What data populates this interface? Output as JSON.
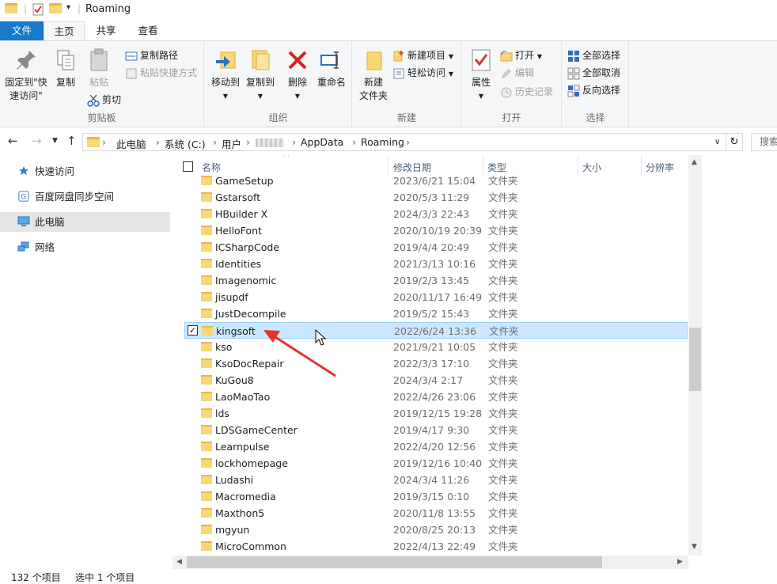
{
  "window": {
    "title": "Roaming"
  },
  "menu": {
    "file": "文件",
    "home": "主页",
    "share": "共享",
    "view": "查看"
  },
  "ribbon": {
    "clipboard": {
      "label": "剪贴板",
      "pin_line1": "固定到\"快",
      "pin_line2": "速访问\"",
      "copy": "复制",
      "paste": "粘贴",
      "copy_path": "复制路径",
      "paste_shortcut": "粘贴快捷方式",
      "cut": "剪切"
    },
    "organize": {
      "label": "组织",
      "move_to": "移动到",
      "copy_to": "复制到",
      "delete": "删除",
      "rename": "重命名"
    },
    "new": {
      "label": "新建",
      "new_item": "新建项目",
      "easy_access": "轻松访问",
      "new_folder_line1": "新建",
      "new_folder_line2": "文件夹"
    },
    "open": {
      "label": "打开",
      "properties": "属性",
      "open": "打开",
      "edit": "编辑",
      "history": "历史记录"
    },
    "select": {
      "label": "选择",
      "select_all": "全部选择",
      "select_none": "全部取消",
      "invert": "反向选择"
    }
  },
  "address": {
    "crumbs": [
      "此电脑",
      "系统 (C:)",
      "用户",
      "AppData",
      "Roaming"
    ],
    "search_placeholder": "搜索"
  },
  "nav": {
    "items": [
      "快速访问",
      "百度网盘同步空间",
      "此电脑",
      "网络"
    ]
  },
  "columns": {
    "name": "名称",
    "date": "修改日期",
    "type": "类型",
    "size": "大小",
    "resolution": "分辨率"
  },
  "files": [
    {
      "name": "GameSetup",
      "date": "2023/6/21 15:04",
      "type": "文件夹"
    },
    {
      "name": "Gstarsoft",
      "date": "2020/5/3 11:29",
      "type": "文件夹"
    },
    {
      "name": "HBuilder X",
      "date": "2024/3/3 22:43",
      "type": "文件夹"
    },
    {
      "name": "HelloFont",
      "date": "2020/10/19 20:39",
      "type": "文件夹"
    },
    {
      "name": "ICSharpCode",
      "date": "2019/4/4 20:49",
      "type": "文件夹"
    },
    {
      "name": "Identities",
      "date": "2021/3/13 10:16",
      "type": "文件夹"
    },
    {
      "name": "Imagenomic",
      "date": "2019/2/3 13:45",
      "type": "文件夹"
    },
    {
      "name": "jisupdf",
      "date": "2020/11/17 16:49",
      "type": "文件夹"
    },
    {
      "name": "JustDecompile",
      "date": "2019/5/2 15:43",
      "type": "文件夹"
    },
    {
      "name": "kingsoft",
      "date": "2022/6/24 13:36",
      "type": "文件夹",
      "selected": true
    },
    {
      "name": "kso",
      "date": "2021/9/21 10:05",
      "type": "文件夹"
    },
    {
      "name": "KsoDocRepair",
      "date": "2022/3/3 17:10",
      "type": "文件夹"
    },
    {
      "name": "KuGou8",
      "date": "2024/3/4 2:17",
      "type": "文件夹"
    },
    {
      "name": "LaoMaoTao",
      "date": "2022/4/26 23:06",
      "type": "文件夹"
    },
    {
      "name": "lds",
      "date": "2019/12/15 19:28",
      "type": "文件夹"
    },
    {
      "name": "LDSGameCenter",
      "date": "2019/4/17 9:30",
      "type": "文件夹"
    },
    {
      "name": "Learnpulse",
      "date": "2022/4/20 12:56",
      "type": "文件夹"
    },
    {
      "name": "lockhomepage",
      "date": "2019/12/16 10:40",
      "type": "文件夹"
    },
    {
      "name": "Ludashi",
      "date": "2024/3/4 11:26",
      "type": "文件夹"
    },
    {
      "name": "Macromedia",
      "date": "2019/3/15 0:10",
      "type": "文件夹"
    },
    {
      "name": "Maxthon5",
      "date": "2020/11/8 13:55",
      "type": "文件夹"
    },
    {
      "name": "mgyun",
      "date": "2020/8/25 20:13",
      "type": "文件夹"
    },
    {
      "name": "MicroCommon",
      "date": "2022/4/13 22:49",
      "type": "文件夹"
    }
  ],
  "status": {
    "count": "132 个项目",
    "selected": "选中 1 个项目"
  },
  "colors": {
    "accent": "#1979ca",
    "selection": "#cce8ff",
    "annotation_arrow": "#e8322d"
  }
}
